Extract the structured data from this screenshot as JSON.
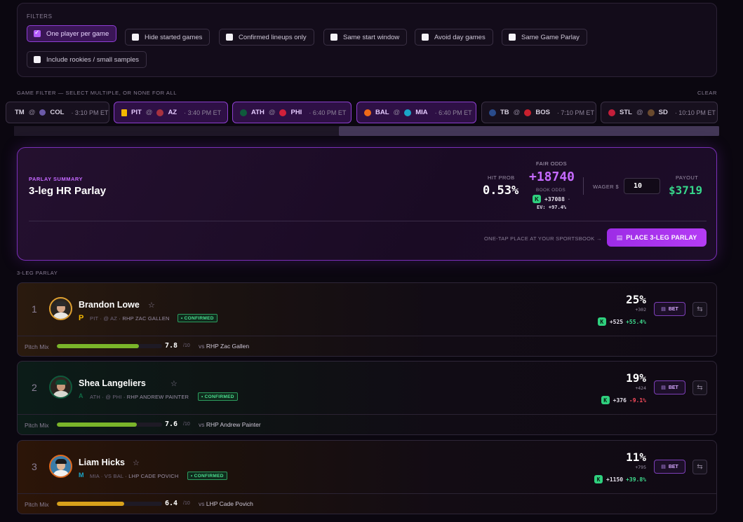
{
  "filters": {
    "title": "FILTERS",
    "chips": [
      {
        "label": "One player per game",
        "checked": true
      },
      {
        "label": "Hide started games",
        "checked": false
      },
      {
        "label": "Confirmed lineups only",
        "checked": false
      },
      {
        "label": "Same start window",
        "checked": false
      },
      {
        "label": "Avoid day games",
        "checked": false
      },
      {
        "label": "Same Game Parlay",
        "checked": false
      },
      {
        "label": "Include rookies / small samples",
        "checked": false
      }
    ]
  },
  "game_filter": {
    "label": "GAME FILTER — SELECT MULTIPLE, OR NONE FOR ALL",
    "clear_label": "CLEAR",
    "games": [
      {
        "away": "TM",
        "at": "@",
        "home": "COL",
        "time": "· 3:10 PM ET",
        "selected": false
      },
      {
        "away": "PIT",
        "at": "@",
        "home": "AZ",
        "time": "· 3:40 PM ET",
        "selected": true
      },
      {
        "away": "ATH",
        "at": "@",
        "home": "PHI",
        "time": "· 6:40 PM ET",
        "selected": true
      },
      {
        "away": "BAL",
        "at": "@",
        "home": "MIA",
        "time": "· 6:40 PM ET",
        "selected": true
      },
      {
        "away": "TB",
        "at": "@",
        "home": "BOS",
        "time": "· 7:10 PM ET",
        "selected": false
      },
      {
        "away": "STL",
        "at": "@",
        "home": "SD",
        "time": "· 10:10 PM ET",
        "selected": false
      }
    ]
  },
  "summary": {
    "label": "PARLAY SUMMARY",
    "title": "3-leg HR Parlay",
    "hit_prob_label": "HIT PROB",
    "hit_prob": "0.53%",
    "fair_odds_label": "FAIR ODDS",
    "fair_odds": "+18740",
    "book_odds_label": "BOOK ODDS",
    "book_icon": "K",
    "book_odds": "+37088",
    "book_sep": "·",
    "ev": "EV: +97.4%",
    "wager_label": "WAGER $",
    "wager_value": "10",
    "payout_label": "PAYOUT",
    "payout": "$3719",
    "one_tap": "ONE-TAP PLACE AT YOUR SPORTSBOOK →",
    "place_label": "PLACE 3-LEG PARLAY"
  },
  "legs_label": "3-LEG PARLAY",
  "legs": [
    {
      "num": "1",
      "name": "Brandon Lowe",
      "star": "☆",
      "team": "PIT",
      "opp": "· @ AZ",
      "pitcher": "· RHP ZAC GALLEN",
      "status": "• CONFIRMED",
      "pct": "25%",
      "odds": "+302",
      "book_line": "+525",
      "edge": "+55.4%",
      "mix_label": "Pitch Mix",
      "mix_score": "7.8",
      "mix_of": "/10",
      "mix_fraction": 0.78,
      "mix_vs": "vs",
      "mix_pitcher": "RHP Zac Gallen",
      "bet_label": "BET"
    },
    {
      "num": "2",
      "name": "Shea Langeliers",
      "star": "☆",
      "team": "ATH",
      "opp": "· @ PHI",
      "pitcher": "· RHP ANDREW PAINTER",
      "status": "• CONFIRMED",
      "pct": "19%",
      "odds": "+424",
      "book_line": "+376",
      "edge": "-9.1%",
      "mix_label": "Pitch Mix",
      "mix_score": "7.6",
      "mix_of": "/10",
      "mix_fraction": 0.76,
      "mix_vs": "vs",
      "mix_pitcher": "RHP Andrew Painter",
      "bet_label": "BET"
    },
    {
      "num": "3",
      "name": "Liam Hicks",
      "star": "☆",
      "team": "MIA",
      "opp": "· VS BAL",
      "pitcher": "· LHP CADE POVICH",
      "status": "• CONFIRMED",
      "pct": "11%",
      "odds": "+795",
      "book_line": "+1150",
      "edge": "+39.8%",
      "mix_label": "Pitch Mix",
      "mix_score": "6.4",
      "mix_of": "/10",
      "mix_fraction": 0.64,
      "mix_vs": "vs",
      "mix_pitcher": "LHP Cade Povich",
      "bet_label": "BET"
    }
  ],
  "colors": {
    "accent": "#b53cf5",
    "positive": "#36d58a",
    "negative": "#ff4d5e",
    "mix_green": "#7ab52a",
    "mix_gold": "#d9a11b"
  }
}
